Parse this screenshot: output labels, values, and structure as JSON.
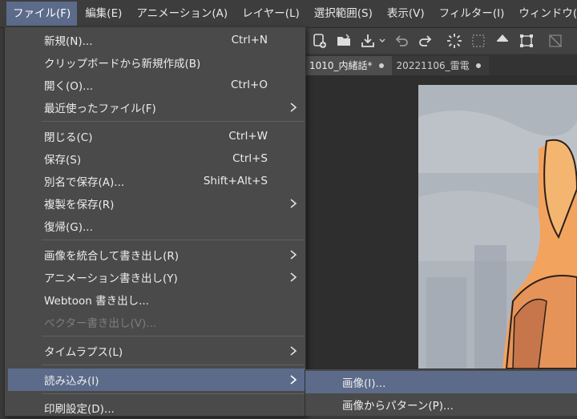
{
  "menubar": {
    "items": [
      {
        "label": "ファイル(F)",
        "active": true
      },
      {
        "label": "編集(E)"
      },
      {
        "label": "アニメーション(A)"
      },
      {
        "label": "レイヤー(L)"
      },
      {
        "label": "選択範囲(S)"
      },
      {
        "label": "表示(V)"
      },
      {
        "label": "フィルター(I)"
      },
      {
        "label": "ウィンドウ("
      }
    ]
  },
  "file_menu": {
    "items": [
      {
        "label": "新規(N)...",
        "shortcut": "Ctrl+N"
      },
      {
        "label": "クリップボードから新規作成(B)"
      },
      {
        "label": "開く(O)...",
        "shortcut": "Ctrl+O"
      },
      {
        "label": "最近使ったファイル(F)",
        "submenu": true
      },
      {
        "label": "閉じる(C)",
        "shortcut": "Ctrl+W"
      },
      {
        "label": "保存(S)",
        "shortcut": "Ctrl+S"
      },
      {
        "label": "別名で保存(A)...",
        "shortcut": "Shift+Alt+S"
      },
      {
        "label": "複製を保存(R)",
        "submenu": true
      },
      {
        "label": "復帰(G)..."
      },
      {
        "label": "画像を統合して書き出し(R)",
        "submenu": true
      },
      {
        "label": "アニメーション書き出し(Y)",
        "submenu": true
      },
      {
        "label": "Webtoon 書き出し..."
      },
      {
        "label": "ベクター書き出し(V)...",
        "disabled": true
      },
      {
        "label": "タイムラプス(L)",
        "submenu": true
      },
      {
        "label": "読み込み(I)",
        "submenu": true,
        "highlighted": true
      },
      {
        "label": "印刷設定(D)..."
      }
    ]
  },
  "import_submenu": {
    "items": [
      {
        "label": "画像(I)...",
        "highlighted": true
      },
      {
        "label": "画像からパターン(P)..."
      }
    ]
  },
  "document_tabs": [
    {
      "label": "1010_内緒話*",
      "active": true
    },
    {
      "label": "20221106_雷電"
    }
  ],
  "toolbar_icons": [
    "new-file-icon",
    "open-folder-icon",
    "save-icon",
    "dropdown-icon",
    "undo-icon",
    "redo-icon",
    "loading-icon",
    "select-off-icon",
    "fill-icon",
    "transform-icon",
    "crop-icon"
  ],
  "colors": {
    "accent": "#5c6b8a",
    "menu_bg": "#4a4a4a",
    "disabled": "#7d7d7d"
  }
}
